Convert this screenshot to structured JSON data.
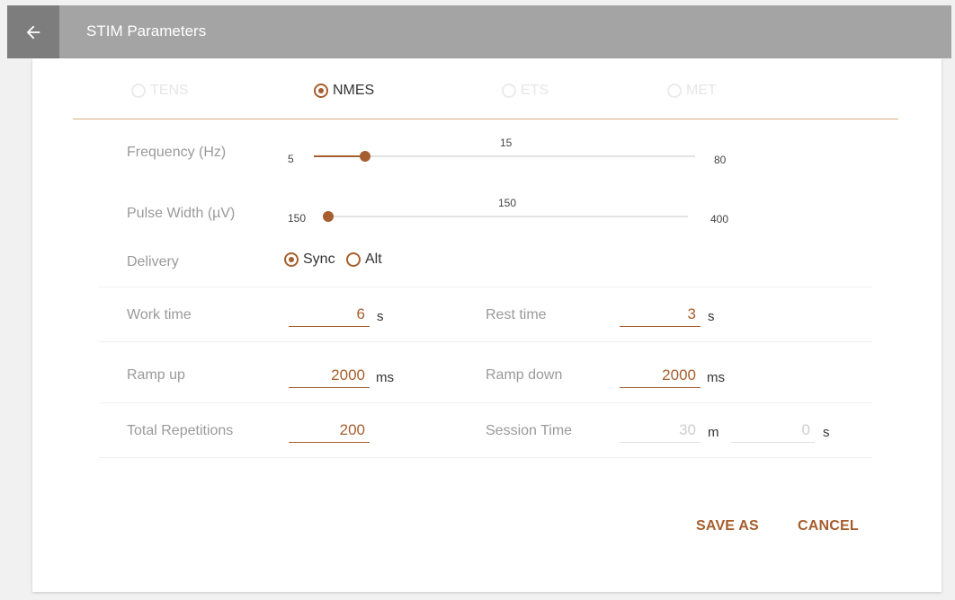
{
  "header": {
    "title": "STIM Parameters",
    "back_icon": "arrow-left-icon"
  },
  "modes": [
    {
      "label": "TENS",
      "selected": false,
      "enabled": false
    },
    {
      "label": "NMES",
      "selected": true,
      "enabled": true
    },
    {
      "label": "ETS",
      "selected": false,
      "enabled": false
    },
    {
      "label": "MET",
      "selected": false,
      "enabled": false
    }
  ],
  "frequency": {
    "label": "Frequency (Hz)",
    "min": "5",
    "max": "80",
    "value": "15",
    "value_num": 15
  },
  "pulse_width": {
    "label": "Pulse Width (µV)",
    "min": "150",
    "max": "400",
    "value": "150",
    "value_num": 150
  },
  "delivery": {
    "label": "Delivery",
    "options": [
      "Sync",
      "Alt"
    ],
    "selected": "Sync"
  },
  "work_time": {
    "label": "Work time",
    "value": "6",
    "unit": "s"
  },
  "rest_time": {
    "label": "Rest time",
    "value": "3",
    "unit": "s"
  },
  "ramp_up": {
    "label": "Ramp up",
    "value": "2000",
    "unit": "ms"
  },
  "ramp_down": {
    "label": "Ramp down",
    "value": "2000",
    "unit": "ms"
  },
  "total_reps": {
    "label": "Total Repetitions",
    "value": "200"
  },
  "session_time": {
    "label": "Session Time",
    "minutes": "30",
    "minutes_unit": "m",
    "seconds": "0",
    "seconds_unit": "s"
  },
  "actions": {
    "save_as": "SAVE AS",
    "cancel": "CANCEL"
  },
  "colors": {
    "accent": "#a65e2e",
    "appbar": "#a4a4a4",
    "back_bg": "#7d7d7d"
  }
}
